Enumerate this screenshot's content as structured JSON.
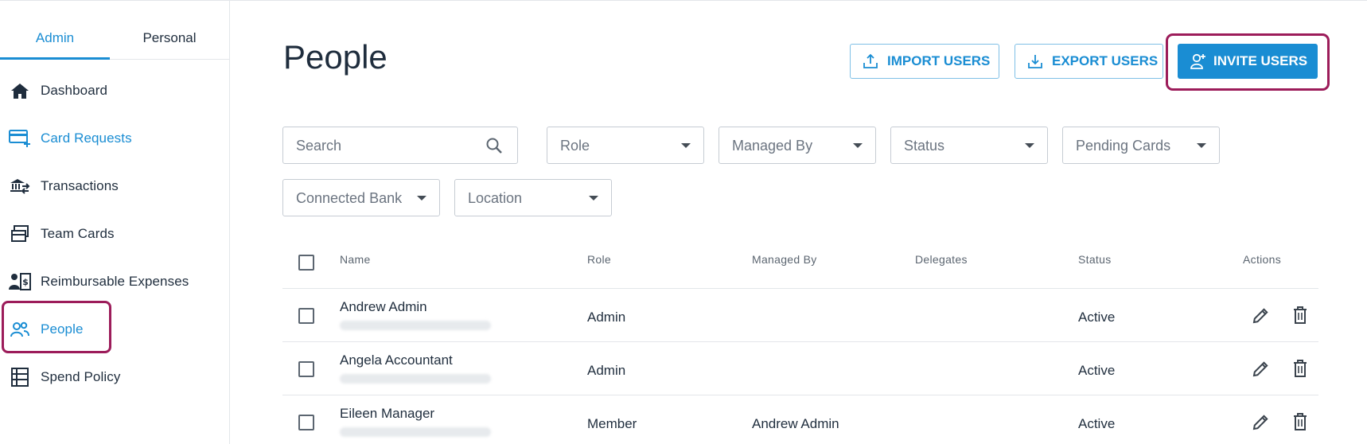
{
  "sidebar": {
    "tabs": [
      {
        "label": "Admin"
      },
      {
        "label": "Personal"
      }
    ],
    "items": [
      {
        "label": "Dashboard",
        "icon": "home-icon"
      },
      {
        "label": "Card Requests",
        "icon": "card-add-icon"
      },
      {
        "label": "Transactions",
        "icon": "bank-transfer-icon"
      },
      {
        "label": "Team Cards",
        "icon": "cards-stack-icon"
      },
      {
        "label": "Reimbursable Expenses",
        "icon": "person-receipt-icon"
      },
      {
        "label": "People",
        "icon": "people-icon"
      },
      {
        "label": "Spend Policy",
        "icon": "list-icon"
      }
    ]
  },
  "header": {
    "title": "People",
    "import_label": "IMPORT USERS",
    "export_label": "EXPORT USERS",
    "invite_label": "INVITE USERS"
  },
  "filters": {
    "search_placeholder": "Search",
    "role": "Role",
    "managed_by": "Managed By",
    "status": "Status",
    "pending_cards": "Pending Cards",
    "connected_bank": "Connected Bank",
    "location": "Location"
  },
  "table": {
    "columns": {
      "name": "Name",
      "role": "Role",
      "managed_by": "Managed By",
      "delegates": "Delegates",
      "status": "Status",
      "actions": "Actions"
    },
    "rows": [
      {
        "name": "Andrew Admin",
        "role": "Admin",
        "managed_by": "",
        "status": "Active"
      },
      {
        "name": "Angela Accountant",
        "role": "Admin",
        "managed_by": "",
        "status": "Active"
      },
      {
        "name": "Eileen Manager",
        "role": "Member",
        "managed_by": "Andrew Admin",
        "status": "Active"
      }
    ]
  },
  "colors": {
    "accent": "#1a8dd3",
    "highlight": "#9c1c5a",
    "text": "#1f2d3d"
  }
}
